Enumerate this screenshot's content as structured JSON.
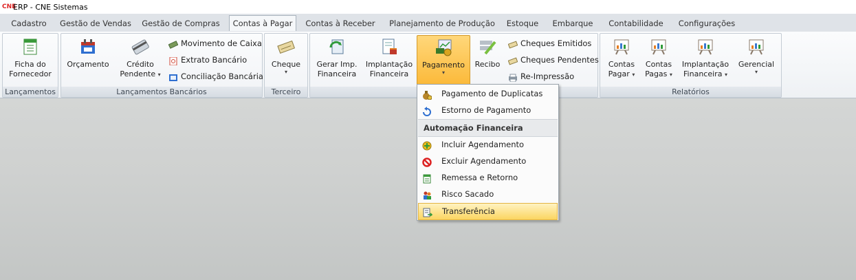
{
  "window": {
    "logo": "CNE",
    "title": "ERP - CNE Sistemas"
  },
  "tabs": [
    "Cadastro",
    "Gestão de Vendas",
    "Gestão de Compras",
    "Contas à Pagar",
    "Contas à Receber",
    "Planejamento de Produção",
    "Estoque",
    "Embarque",
    "Contabilidade",
    "Configurações"
  ],
  "active_tab": "Contas à Pagar",
  "groups": {
    "lancamentos": {
      "label": "Lançamentos",
      "ficha_line1": "Ficha do",
      "ficha_line2": "Fornecedor"
    },
    "bancarios": {
      "label": "Lançamentos Bancários",
      "orcamento": "Orçamento",
      "credito_line1": "Crédito",
      "credito_line2": "Pendente",
      "movimento": "Movimento de Caixa",
      "extrato": "Extrato Bancário",
      "conciliacao": "Conciliação Bancária"
    },
    "terceiro": {
      "label": "Terceiro",
      "cheque": "Cheque"
    },
    "financeiro": {
      "gerar_line1": "Gerar Imp.",
      "gerar_line2": "Financeira",
      "implantacao_line1": "Implantação",
      "implantacao_line2": "Financeira",
      "pagamento": "Pagamento",
      "recibo": "Recibo",
      "cheques_emitidos": "Cheques Emitidos",
      "cheques_pendentes": "Cheques Pendentes",
      "reimpressao": "Re-Impressão"
    },
    "relatorios": {
      "label": "Relatórios",
      "contas_pagar_1": "Contas",
      "contas_pagar_2": "Pagar",
      "contas_pagas_1": "Contas",
      "contas_pagas_2": "Pagas",
      "impl_1": "Implantação",
      "impl_2": "Financeira",
      "gerencial": "Gerencial"
    }
  },
  "dropdown": {
    "items_top": [
      "Pagamento de Duplicatas",
      "Estorno de Pagamento"
    ],
    "section_header": "Automação Financeira",
    "items_bottom": [
      "Incluir Agendamento",
      "Excluir Agendamento",
      "Remessa e Retorno",
      "Risco Sacado",
      "Transferência"
    ],
    "highlighted": "Transferência"
  },
  "colors": {
    "accent_pressed": "#fbb939",
    "highlight": "#fbd561",
    "logo_red": "#d22222"
  }
}
